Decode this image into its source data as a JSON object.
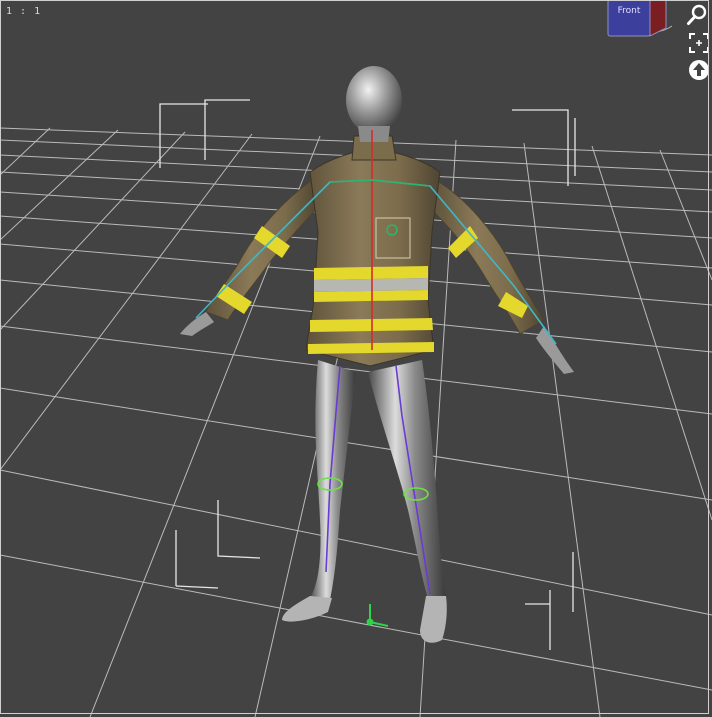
{
  "viewport": {
    "zoom_label": "1 : 1",
    "background_color": "#434343",
    "grid_color": "#cfcfcf"
  },
  "view_cube": {
    "face_label": "Front",
    "face_color": "#3d3f9c"
  },
  "nav_controls": [
    {
      "name": "zoom-icon",
      "icon": "magnifier"
    },
    {
      "name": "frame-selection-icon",
      "icon": "frame-brackets"
    },
    {
      "name": "reset-view-icon",
      "icon": "up-arrow-circle"
    }
  ],
  "figure": {
    "jacket_color": "#857352",
    "stripe_yellow": "#e3d82b",
    "stripe_silver": "#b7b7b2",
    "skin_color": "#9b9b9b"
  }
}
